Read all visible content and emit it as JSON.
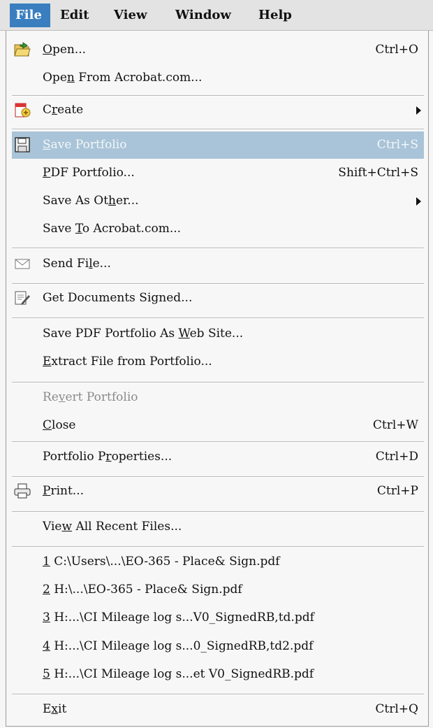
{
  "menubar": {
    "items": [
      {
        "label": "File",
        "active": true
      },
      {
        "label": "Edit"
      },
      {
        "label": "View"
      },
      {
        "label": "Window"
      },
      {
        "label": "Help"
      }
    ]
  },
  "menu": {
    "items": [
      {
        "id": "open",
        "pre": "",
        "ul": "O",
        "post": "pen...",
        "shortcut": "Ctrl+O",
        "icon": "open-folder-icon"
      },
      {
        "id": "open-acrobat",
        "pre": "Ope",
        "ul": "n",
        "post": " From Acrobat.com...",
        "shortcut": ""
      },
      {
        "id": "create",
        "pre": "C",
        "ul": "r",
        "post": "eate",
        "shortcut": "",
        "icon": "create-pdf-icon",
        "submenu": true
      },
      {
        "id": "save-portfolio",
        "pre": "",
        "ul": "S",
        "post": "ave Portfolio",
        "shortcut": "Ctrl+S",
        "icon": "save-disk-icon",
        "highlighted": true
      },
      {
        "id": "pdf-portfolio",
        "pre": "",
        "ul": "P",
        "post": "DF Portfolio...",
        "shortcut": "Shift+Ctrl+S"
      },
      {
        "id": "save-as-other",
        "pre": "Save As Ot",
        "ul": "h",
        "post": "er...",
        "shortcut": "",
        "submenu": true
      },
      {
        "id": "save-to-acrobat",
        "pre": "Save ",
        "ul": "T",
        "post": "o Acrobat.com...",
        "shortcut": ""
      },
      {
        "id": "send-file",
        "pre": "Send Fi",
        "ul": "l",
        "post": "e...",
        "shortcut": "",
        "icon": "envelope-icon"
      },
      {
        "id": "get-signed",
        "pre": "Get Documents Signed...",
        "ul": "",
        "post": "",
        "shortcut": "",
        "icon": "sign-document-icon"
      },
      {
        "id": "save-web",
        "pre": "Save PDF Portfolio As ",
        "ul": "W",
        "post": "eb Site...",
        "shortcut": ""
      },
      {
        "id": "extract",
        "pre": "",
        "ul": "E",
        "post": "xtract File from Portfolio...",
        "shortcut": ""
      },
      {
        "id": "revert",
        "pre": "Re",
        "ul": "v",
        "post": "ert Portfolio",
        "shortcut": "",
        "disabled": true
      },
      {
        "id": "close",
        "pre": "",
        "ul": "C",
        "post": "lose",
        "shortcut": "Ctrl+W"
      },
      {
        "id": "properties",
        "pre": "Portfolio P",
        "ul": "r",
        "post": "operties...",
        "shortcut": "Ctrl+D"
      },
      {
        "id": "print",
        "pre": "",
        "ul": "P",
        "post": "rint...",
        "shortcut": "Ctrl+P",
        "icon": "printer-icon"
      },
      {
        "id": "recent-all",
        "pre": "Vie",
        "ul": "w",
        "post": " All Recent Files...",
        "shortcut": ""
      },
      {
        "id": "recent-1",
        "pre": "",
        "ul": "1",
        "post": " C:\\Users\\...\\EO-365 - Place& Sign.pdf",
        "shortcut": ""
      },
      {
        "id": "recent-2",
        "pre": "",
        "ul": "2",
        "post": " H:\\...\\EO-365 - Place& Sign.pdf",
        "shortcut": ""
      },
      {
        "id": "recent-3",
        "pre": "",
        "ul": "3",
        "post": " H:...\\CI  Mileage log s...V0_SignedRB,td.pdf",
        "shortcut": ""
      },
      {
        "id": "recent-4",
        "pre": "",
        "ul": "4",
        "post": " H:...\\CI  Mileage log s...0_SignedRB,td2.pdf",
        "shortcut": ""
      },
      {
        "id": "recent-5",
        "pre": "",
        "ul": "5",
        "post": " H:...\\CI  Mileage log s...et V0_SignedRB.pdf",
        "shortcut": ""
      },
      {
        "id": "exit",
        "pre": "E",
        "ul": "x",
        "post": "it",
        "shortcut": "Ctrl+Q"
      }
    ]
  },
  "colors": {
    "highlight": "#a9c4d8",
    "menubar_active": "#3a7ebf",
    "disabled_text": "#8a8a8a"
  }
}
